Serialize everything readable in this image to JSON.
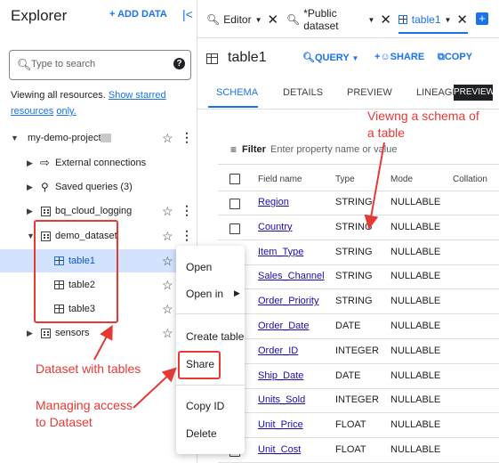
{
  "explorer": {
    "title": "Explorer",
    "add_data": "+ ADD DATA",
    "search_placeholder": "Type to search",
    "viewing_text": "Viewing all resources.",
    "starred_link": "Show starred resources",
    "only_link": "only.",
    "project": "my-demo-project",
    "items": [
      {
        "label": "External connections"
      },
      {
        "label": "Saved queries (3)"
      },
      {
        "label": "bq_cloud_logging"
      },
      {
        "label": "demo_dataset"
      },
      {
        "label": "table1"
      },
      {
        "label": "table2"
      },
      {
        "label": "table3"
      },
      {
        "label": "sensors"
      }
    ]
  },
  "tabs": [
    {
      "label": "Editor"
    },
    {
      "label": "*Public dataset"
    },
    {
      "label": "table1"
    }
  ],
  "table_header": {
    "title": "table1",
    "query": "QUERY",
    "share": "SHARE",
    "copy": "COPY"
  },
  "subtabs": [
    "SCHEMA",
    "DETAILS",
    "PREVIEW",
    "LINEAGE",
    "PREVIEW"
  ],
  "filter": {
    "label": "Filter",
    "placeholder": "Enter property name or value"
  },
  "schema": {
    "columns": [
      "Field name",
      "Type",
      "Mode",
      "Collation"
    ],
    "rows": [
      {
        "name": "Region",
        "type": "STRING",
        "mode": "NULLABLE"
      },
      {
        "name": "Country",
        "type": "STRING",
        "mode": "NULLABLE"
      },
      {
        "name": "Item_Type",
        "type": "STRING",
        "mode": "NULLABLE"
      },
      {
        "name": "Sales_Channel",
        "type": "STRING",
        "mode": "NULLABLE"
      },
      {
        "name": "Order_Priority",
        "type": "STRING",
        "mode": "NULLABLE"
      },
      {
        "name": "Order_Date",
        "type": "DATE",
        "mode": "NULLABLE"
      },
      {
        "name": "Order_ID",
        "type": "INTEGER",
        "mode": "NULLABLE"
      },
      {
        "name": "Ship_Date",
        "type": "DATE",
        "mode": "NULLABLE"
      },
      {
        "name": "Units_Sold",
        "type": "INTEGER",
        "mode": "NULLABLE"
      },
      {
        "name": "Unit_Price",
        "type": "FLOAT",
        "mode": "NULLABLE"
      },
      {
        "name": "Unit_Cost",
        "type": "FLOAT",
        "mode": "NULLABLE"
      }
    ]
  },
  "context_menu": {
    "open": "Open",
    "open_in": "Open in",
    "create_table": "Create table",
    "share": "Share",
    "copy_id": "Copy ID",
    "delete": "Delete"
  },
  "annotations": {
    "schema_note": "Viewng a schema of\na table",
    "dataset_note": "Dataset with tables",
    "access_note": "Managing access\nto Dataset"
  },
  "colors": {
    "accent": "#1a73e8",
    "annotation": "#e53935",
    "selected": "#d3e3fd"
  }
}
